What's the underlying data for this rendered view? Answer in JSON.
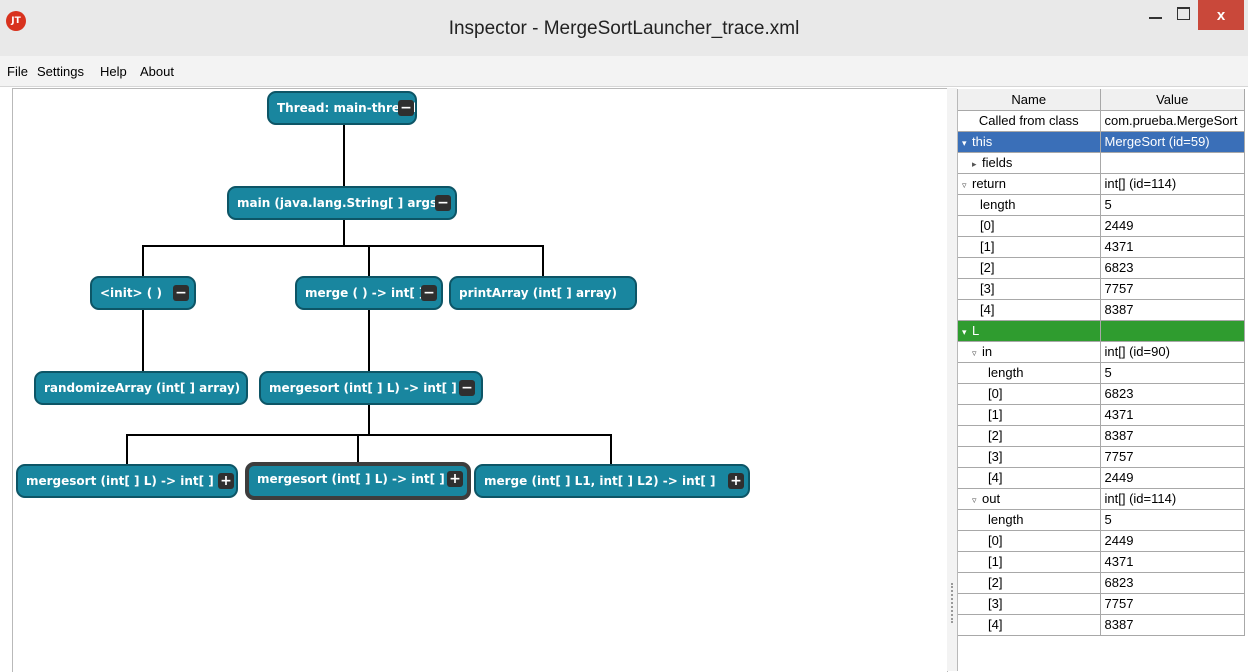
{
  "window": {
    "title": "Inspector - MergeSortLauncher_trace.xml",
    "app_icon_text": "JT",
    "close_glyph": "x"
  },
  "menu": [
    "File",
    "Settings",
    "Help",
    "About"
  ],
  "tree": {
    "nodes": [
      {
        "label": "Thread: main-thread",
        "button": "−"
      },
      {
        "label": "main (java.lang.String[ ] args)",
        "button": "−"
      },
      {
        "label": "<init> ( )",
        "button": "−"
      },
      {
        "label": "merge ( ) -> int[ ]",
        "button": "−"
      },
      {
        "label": "printArray (int[ ] array)",
        "button": ""
      },
      {
        "label": "randomizeArray (int[ ] array)",
        "button": ""
      },
      {
        "label": "mergesort (int[ ] L) -> int[ ]",
        "button": "−"
      },
      {
        "label": "mergesort (int[ ] L) -> int[ ]",
        "button": "+"
      },
      {
        "label": "mergesort (int[ ] L) -> int[ ]",
        "button": "+"
      },
      {
        "label": "merge (int[ ] L1, int[ ] L2) -> int[ ]",
        "button": "+"
      }
    ],
    "node_color": "#19869f"
  },
  "props": {
    "headers": {
      "name": "Name",
      "value": "Value"
    },
    "rows": [
      {
        "name": "Called from class",
        "value": "com.prueba.MergeSort",
        "indent": 0,
        "tri": "",
        "center": true
      },
      {
        "name": "this",
        "value": "MergeSort (id=59)",
        "indent": 0,
        "tri": "▾",
        "style": "sel-this"
      },
      {
        "name": "fields",
        "value": "",
        "indent": 1,
        "tri": "▸"
      },
      {
        "name": "return",
        "value": "int[] (id=114)",
        "indent": 0,
        "tri": "▿"
      },
      {
        "name": "length",
        "value": "5",
        "indent": 2,
        "tri": ""
      },
      {
        "name": "[0]",
        "value": "2449",
        "indent": 2,
        "tri": ""
      },
      {
        "name": "[1]",
        "value": "4371",
        "indent": 2,
        "tri": ""
      },
      {
        "name": "[2]",
        "value": "6823",
        "indent": 2,
        "tri": ""
      },
      {
        "name": "[3]",
        "value": "7757",
        "indent": 2,
        "tri": ""
      },
      {
        "name": "[4]",
        "value": "8387",
        "indent": 2,
        "tri": ""
      },
      {
        "name": "L",
        "value": "",
        "indent": 0,
        "tri": "▾",
        "style": "sel-L"
      },
      {
        "name": "in",
        "value": "int[] (id=90)",
        "indent": 1,
        "tri": "▿"
      },
      {
        "name": "length",
        "value": "5",
        "indent": 3,
        "tri": ""
      },
      {
        "name": "[0]",
        "value": "6823",
        "indent": 3,
        "tri": ""
      },
      {
        "name": "[1]",
        "value": "4371",
        "indent": 3,
        "tri": ""
      },
      {
        "name": "[2]",
        "value": "8387",
        "indent": 3,
        "tri": ""
      },
      {
        "name": "[3]",
        "value": "7757",
        "indent": 3,
        "tri": ""
      },
      {
        "name": "[4]",
        "value": "2449",
        "indent": 3,
        "tri": ""
      },
      {
        "name": "out",
        "value": "int[] (id=114)",
        "indent": 1,
        "tri": "▿"
      },
      {
        "name": "length",
        "value": "5",
        "indent": 3,
        "tri": ""
      },
      {
        "name": "[0]",
        "value": "2449",
        "indent": 3,
        "tri": ""
      },
      {
        "name": "[1]",
        "value": "4371",
        "indent": 3,
        "tri": ""
      },
      {
        "name": "[2]",
        "value": "6823",
        "indent": 3,
        "tri": ""
      },
      {
        "name": "[3]",
        "value": "7757",
        "indent": 3,
        "tri": ""
      },
      {
        "name": "[4]",
        "value": "8387",
        "indent": 3,
        "tri": ""
      }
    ]
  }
}
